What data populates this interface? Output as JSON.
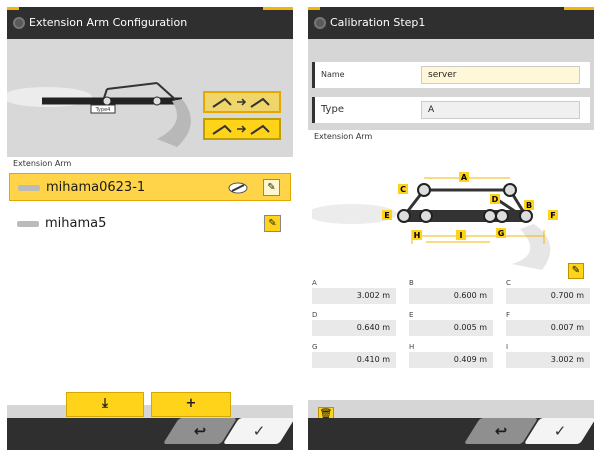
{
  "screen1": {
    "title": "Extension Arm Configuration",
    "section_label": "Extension Arm",
    "preview_tag": "Type4",
    "items": [
      {
        "name": "mihama0623-1",
        "selected": true
      },
      {
        "name": "mihama5",
        "selected": false
      }
    ],
    "import_icon": "⤓",
    "add_label": "+",
    "back_icon": "↩",
    "ok_icon": "✓"
  },
  "screen2": {
    "title": "Calibration Step1",
    "name_label": "Name",
    "name_value": "server",
    "type_label": "Type",
    "type_value": "A",
    "section_label": "Extension Arm",
    "diagram_labels": [
      "A",
      "B",
      "C",
      "D",
      "E",
      "F",
      "G",
      "H",
      "I"
    ],
    "values": [
      {
        "label": "A",
        "value": "3.002 m"
      },
      {
        "label": "B",
        "value": "0.600 m"
      },
      {
        "label": "C",
        "value": "0.700 m"
      },
      {
        "label": "D",
        "value": "0.640 m"
      },
      {
        "label": "E",
        "value": "0.005 m"
      },
      {
        "label": "F",
        "value": "0.007 m"
      },
      {
        "label": "G",
        "value": "0.410 m"
      },
      {
        "label": "H",
        "value": "0.409 m"
      },
      {
        "label": "I",
        "value": "3.002 m"
      }
    ],
    "back_icon": "↩",
    "ok_icon": "✓"
  },
  "colors": {
    "accent": "#ffd31a",
    "bar": "#2f2f2f"
  }
}
